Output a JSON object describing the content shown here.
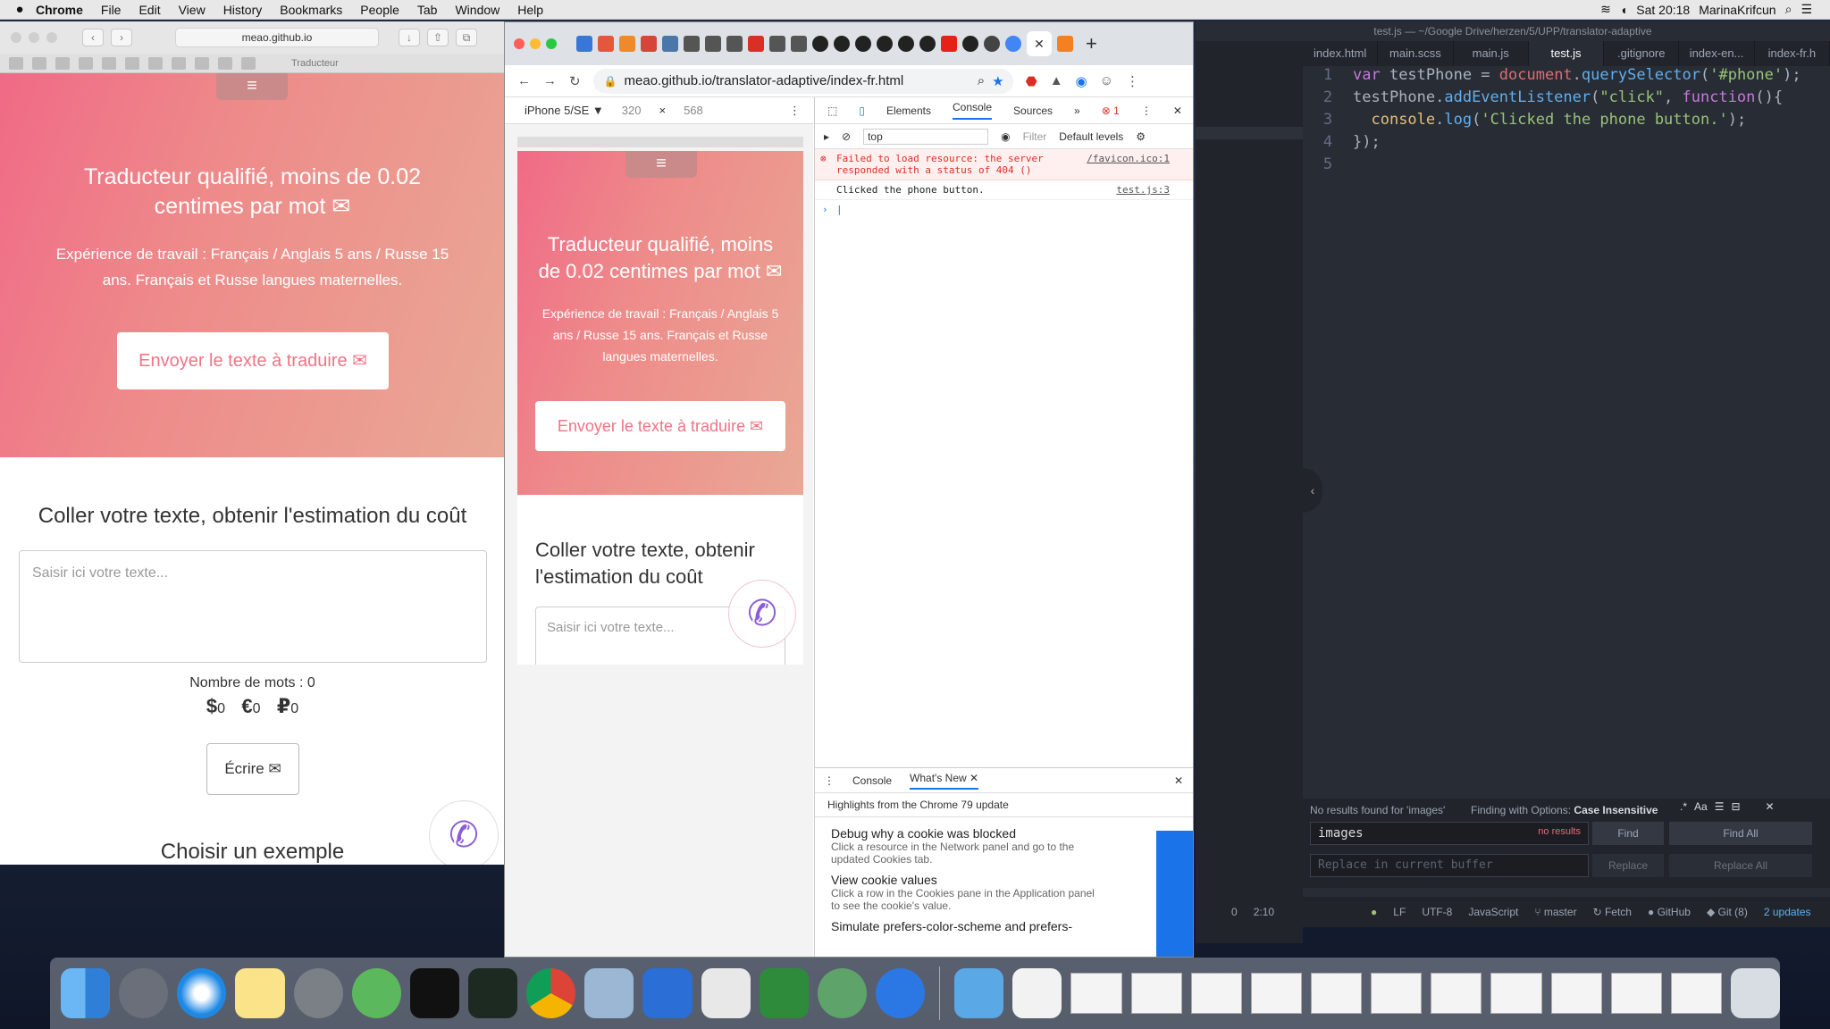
{
  "menubar": {
    "app": "Chrome",
    "items": [
      "File",
      "Edit",
      "View",
      "History",
      "Bookmarks",
      "People",
      "Tab",
      "Window",
      "Help"
    ],
    "clock": "Sat 20:18",
    "user": "MarinaKrifcun"
  },
  "safari": {
    "url": "meao.github.io",
    "tab_label": "Traducteur"
  },
  "site": {
    "title": "Traducteur qualifié, moins de 0.02 centimes par mot ✉",
    "subtitle": "Expérience de travail : Français / Anglais 5 ans / Russe 15 ans. Français et Russe langues maternelles.",
    "cta": "Envoyer le texte à traduire ✉",
    "section_title": "Coller votre texte, obtenir l'estimation du coût",
    "textarea_placeholder": "Saisir ici votre texte...",
    "word_count": "Nombre de mots : 0",
    "price_usd": "0",
    "price_eur": "0",
    "price_rub": "0",
    "write_button": "Écrire ✉",
    "examples_title": "Choisir un exemple"
  },
  "chrome": {
    "url": "meao.github.io/translator-adaptive/index-fr.html",
    "device": "iPhone 5/SE ▼",
    "width": "320",
    "height": "568"
  },
  "devtools": {
    "tabs": [
      "Elements",
      "Console",
      "Sources"
    ],
    "active_tab": "Console",
    "error_count": "1",
    "context": "top",
    "filter_placeholder": "Filter",
    "levels": "Default levels",
    "error_msg": "Failed to load resource: the server responded with a status of 404 ()",
    "error_src": "/favicon.ico:1",
    "log_msg": "Clicked the phone button.",
    "log_src": "test.js:3",
    "drawer_tabs": [
      "Console",
      "What's New"
    ],
    "drawer_heading": "Highlights from the Chrome 79 update",
    "news": [
      {
        "title": "Debug why a cookie was blocked",
        "body": "Click a resource in the Network panel and go to the updated Cookies tab."
      },
      {
        "title": "View cookie values",
        "body": "Click a row in the Cookies pane in the Application panel to see the cookie's value."
      },
      {
        "title": "Simulate prefers-color-scheme and prefers-",
        "body": ""
      }
    ]
  },
  "editor": {
    "title": "test.js — ~/Google Drive/herzen/5/UPP/translator-adaptive",
    "tabs": [
      "index.html",
      "main.scss",
      "main.js",
      "test.js",
      ".gitignore",
      "index-en...",
      "index-fr.h"
    ],
    "active_tab": "test.js",
    "line_numbers": [
      "1",
      "2",
      "3",
      "4",
      "5"
    ],
    "find_status": "No results found for 'images'",
    "find_options_label": "Finding with Options:",
    "find_options_value": "Case Insensitive",
    "find_query": "images",
    "no_results": "no results",
    "find_btn": "Find",
    "find_all_btn": "Find All",
    "replace_placeholder": "Replace in current buffer",
    "replace_btn": "Replace",
    "replace_all_btn": "Replace All",
    "status": {
      "pos0": "0",
      "cursor": "2:10",
      "eol": "LF",
      "enc": "UTF-8",
      "grammar": "JavaScript",
      "branch": "master",
      "fetch": "Fetch",
      "github": "GitHub",
      "git": "Git (8)",
      "updates": "2 updates"
    }
  }
}
